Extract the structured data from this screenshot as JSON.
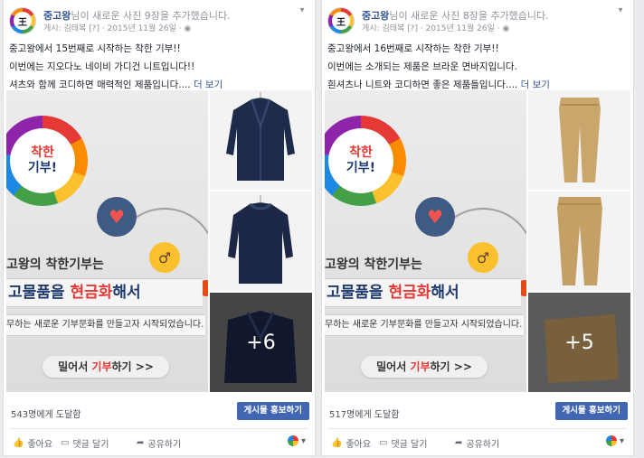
{
  "posts": [
    {
      "page_name": "중고왕",
      "action_text": "님이 새로운 사진 9장을 추가했습니다.",
      "meta": "게시: 김태복 [?] · 2015년 11월 26일 · ◉",
      "avatar_text": "王",
      "body": [
        "중고왕에서 15번째로 시작하는 착한 기부!!",
        "이번에는 지오다노 네이비 가디건 니트입니다!!",
        "셔츠와 함께 코디하면 매력적인 제품입니다...."
      ],
      "more_link": "더 보기",
      "more_count": "+6",
      "reach": "543명에게 도달함",
      "boost": "게시물 홍보하기",
      "thumb_style": "cardigan"
    },
    {
      "page_name": "중고왕",
      "action_text": "님이 새로운 사진 8장을 추가했습니다.",
      "meta": "게시: 김태복 [?] · 2015년 11월 26일 · ◉",
      "avatar_text": "王",
      "body": [
        "중고왕에서 16번째로 시작하는 착한 기부!!",
        "이번에는 소개되는 제품은 브라운 면바지입니다.",
        "흰셔츠나 니트와 코디하면 좋은 제품들입니다...."
      ],
      "more_link": "더 보기",
      "more_count": "+5",
      "reach": "517명에게 도달함",
      "boost": "게시물 홍보하기",
      "thumb_style": "pants"
    }
  ],
  "banner": {
    "slogan_1": "착한",
    "slogan_2": "기부!",
    "line_1": "고왕의 착한기부는",
    "line_2_pre": "고물품을 ",
    "line_2_hl": "현금화",
    "line_2_post": "해서",
    "line_3": "무하는 새로운 기부문화를 만들고자 시작되었습니다.",
    "cta_pre": "밀어서 ",
    "cta_hl": "기부",
    "cta_post": "하기 >>"
  },
  "actions": {
    "like": "좋아요",
    "comment": "댓글 달기",
    "share": "공유하기"
  },
  "icons": {
    "like": "thumbs-up-icon",
    "comment": "comment-icon",
    "share": "share-icon",
    "chevron": "chevron-down-icon",
    "globe": "globe-icon"
  },
  "colors": {
    "fb_blue": "#4267b2",
    "link": "#365899",
    "cardigan": "#1f2b4d",
    "pants": "#c9a66b"
  }
}
